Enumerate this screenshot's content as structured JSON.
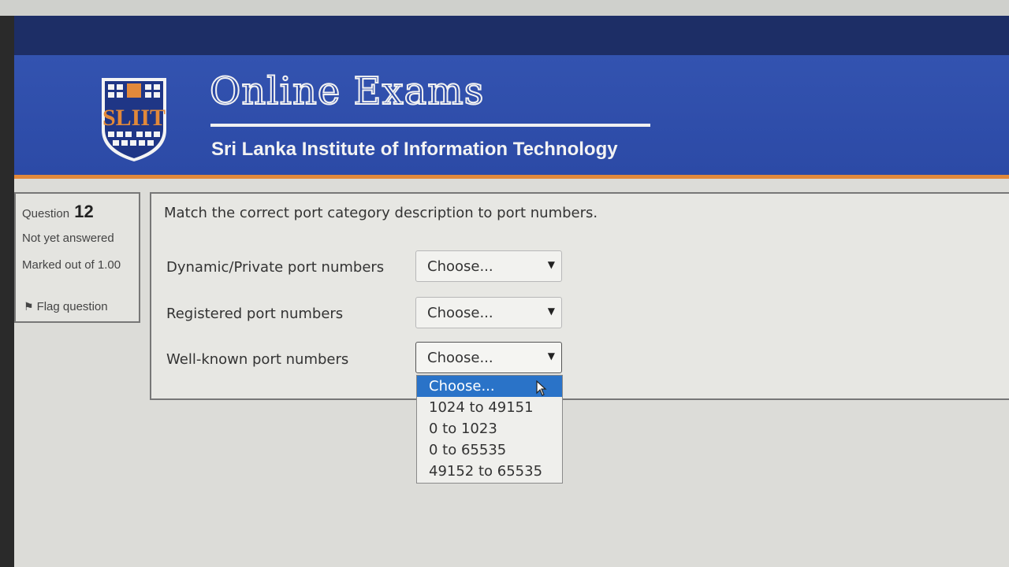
{
  "header": {
    "title": "Online Exams",
    "subtitle": "Sri Lanka Institute of Information Technology",
    "logo_text": "SLIIT",
    "colors": {
      "bar": "#2c4aa6",
      "accent": "#e2893a"
    }
  },
  "question_info": {
    "label": "Question",
    "number": "12",
    "state": "Not yet answered",
    "grade": "Marked out of 1.00",
    "flag_label": "Flag question",
    "flag_icon": "flag-icon"
  },
  "question": {
    "text": "Match the correct port category description to port numbers.",
    "rows": [
      {
        "label": "Dynamic/Private port numbers",
        "selected": "Choose..."
      },
      {
        "label": "Registered port numbers",
        "selected": "Choose..."
      },
      {
        "label": "Well-known port numbers",
        "selected": "Choose..."
      }
    ]
  },
  "dropdown": {
    "options": [
      "Choose...",
      "1024 to 49151",
      "0 to 1023",
      "0 to 65535",
      "49152 to 65535"
    ],
    "highlighted_color": "#2a73c8"
  }
}
